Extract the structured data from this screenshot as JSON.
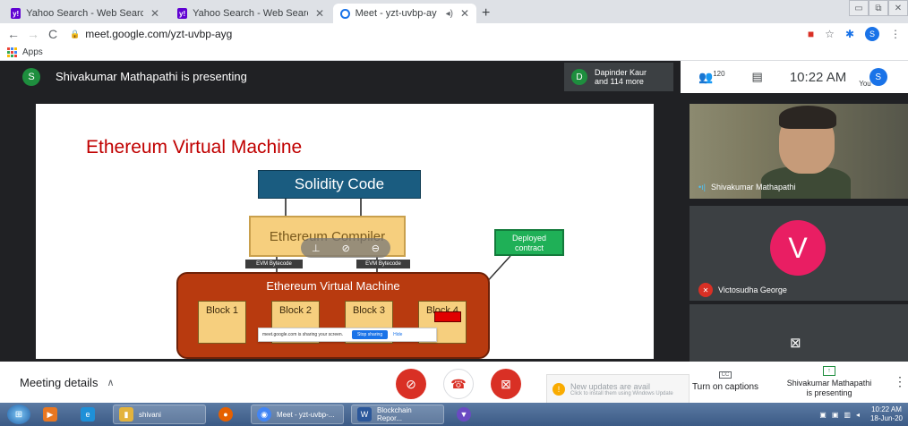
{
  "browser": {
    "tabs": [
      {
        "title": "Yahoo Search - Web Search",
        "favicon": "yahoo-icon",
        "active": false
      },
      {
        "title": "Yahoo Search - Web Search",
        "favicon": "yahoo-icon",
        "active": false
      },
      {
        "title": "Meet - yzt-uvbp-ayg",
        "favicon": "meet-icon",
        "active": true
      }
    ],
    "url": "meet.google.com/yzt-uvbp-ayg",
    "bookmarks_label": "Apps",
    "profile_initial": "S"
  },
  "meet": {
    "presenter_initial": "S",
    "presenting_text": "Shivakumar Mathapathi is presenting",
    "participants": {
      "initial": "D",
      "line1": "Dapinder Kaur",
      "line2": "and 114 more"
    },
    "people_count": "120",
    "time": "10:22 AM",
    "you_label": "You",
    "self_initial": "S",
    "tiles": [
      {
        "name": "Shivakumar Mathapathi"
      },
      {
        "name": "Victosudha George",
        "initial": "V"
      }
    ],
    "meeting_details": "Meeting details",
    "captions_label": "Turn on captions",
    "present_label_1": "Shivakumar Mathapathi",
    "present_label_2": "is presenting",
    "toast_title": "New updates are avail",
    "toast_sub": "Click to install them using Windows Update"
  },
  "slide": {
    "title": "Ethereum Virtual Machine",
    "solidity": "Solidity Code",
    "compiler": "Ethereum Compiler",
    "bytecode_left": "EVM Bytecode",
    "bytecode_right": "EVM Bytecode",
    "deployed_line1": "Deployed",
    "deployed_line2": "contract",
    "evm": "Ethereum Virtual Machine",
    "blocks": [
      "Block 1",
      "Block 2",
      "Block 3",
      "Block 4"
    ],
    "share_text": "meet.google.com is sharing your screen.",
    "stop_sharing": "Stop sharing",
    "hide": "Hide"
  },
  "taskbar": {
    "items": [
      "shivani",
      "Meet - yzt-uvbp-...",
      "Blockchain Repor..."
    ],
    "time": "10:22 AM",
    "date": "18-Jun-20"
  },
  "colors": {
    "meet_bg": "#202124",
    "accent_red": "#d93025",
    "accent_blue": "#1a73e8",
    "slide_title_red": "#c00000"
  }
}
